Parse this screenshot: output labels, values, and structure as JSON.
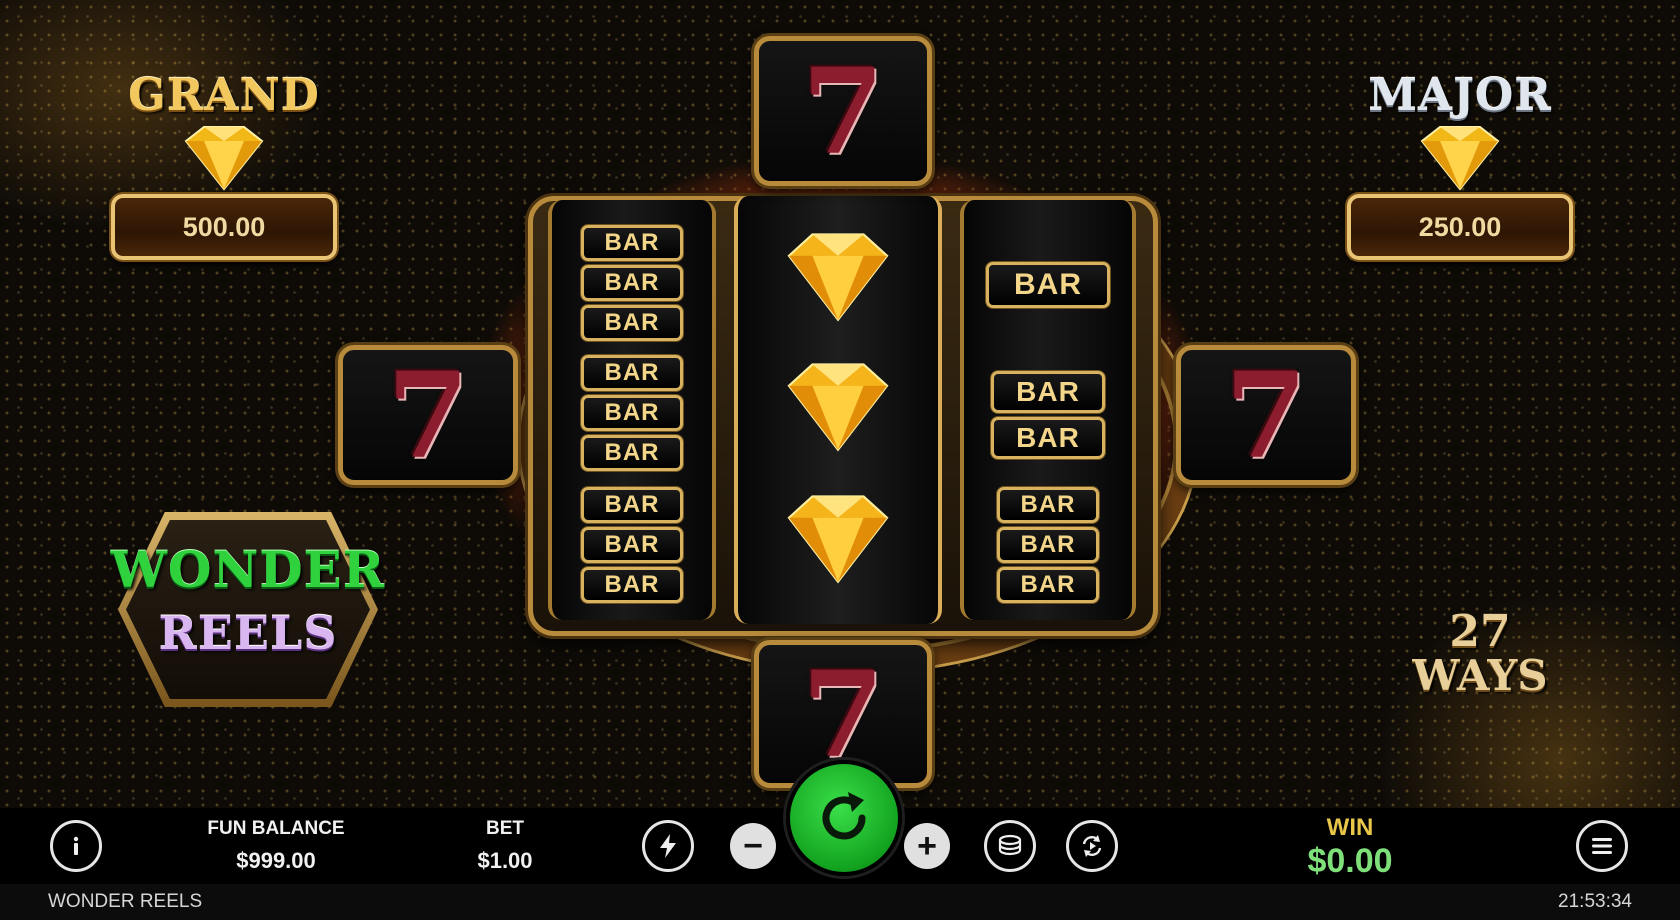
{
  "jackpots": {
    "grand": {
      "title": "GRAND",
      "value": "500.00"
    },
    "major": {
      "title": "MAJOR",
      "value": "250.00"
    }
  },
  "logo": {
    "word1": "WONDER",
    "word2": "REELS"
  },
  "ways": {
    "number": "27",
    "label": "WAYS"
  },
  "reels": {
    "bar_text": "BAR",
    "seven_text": "7",
    "left": [
      "triple-bar",
      "triple-bar",
      "triple-bar"
    ],
    "center": [
      "diamond",
      "diamond",
      "diamond"
    ],
    "right": [
      "single-bar",
      "double-bar",
      "triple-bar"
    ],
    "side": {
      "top": "seven",
      "bottom": "seven",
      "left": "seven",
      "right": "seven"
    }
  },
  "hud": {
    "balance_label": "FUN BALANCE",
    "balance_value": "$999.00",
    "bet_label": "BET",
    "bet_value": "$1.00",
    "minus": "−",
    "plus": "+",
    "win_label": "WIN",
    "win_value": "$0.00"
  },
  "footer": {
    "game_title": "WONDER REELS",
    "clock": "21:53:34"
  },
  "icons": {
    "info": "info-icon",
    "turbo": "lightning-icon",
    "spin": "spin-arrow-icon",
    "coins": "coin-stack-icon",
    "autoplay": "autoplay-icon",
    "menu": "hamburger-menu-icon"
  },
  "colors": {
    "win_green": "#7fe07a",
    "win_gold": "#e7c64a",
    "spin_green": "#12a21f"
  }
}
